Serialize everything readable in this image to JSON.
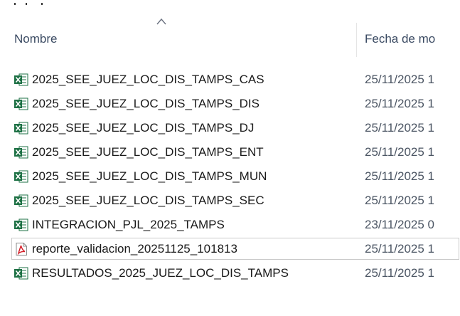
{
  "columns": {
    "name": "Nombre",
    "date": "Fecha de mo"
  },
  "files": [
    {
      "name": "2025_SEE_JUEZ_LOC_DIS_TAMPS_CAS",
      "date": "25/11/2025 1",
      "type": "excel"
    },
    {
      "name": "2025_SEE_JUEZ_LOC_DIS_TAMPS_DIS",
      "date": "25/11/2025 1",
      "type": "excel"
    },
    {
      "name": "2025_SEE_JUEZ_LOC_DIS_TAMPS_DJ",
      "date": "25/11/2025 1",
      "type": "excel"
    },
    {
      "name": "2025_SEE_JUEZ_LOC_DIS_TAMPS_ENT",
      "date": "25/11/2025 1",
      "type": "excel"
    },
    {
      "name": "2025_SEE_JUEZ_LOC_DIS_TAMPS_MUN",
      "date": "25/11/2025 1",
      "type": "excel"
    },
    {
      "name": "2025_SEE_JUEZ_LOC_DIS_TAMPS_SEC",
      "date": "25/11/2025 1",
      "type": "excel"
    },
    {
      "name": "INTEGRACION_PJL_2025_TAMPS",
      "date": "23/11/2025 0",
      "type": "excel"
    },
    {
      "name": "reporte_validacion_20251125_101813",
      "date": "25/11/2025 1",
      "type": "pdf"
    },
    {
      "name": "RESULTADOS_2025_JUEZ_LOC_DIS_TAMPS",
      "date": "25/11/2025 1",
      "type": "excel"
    }
  ],
  "icons": {
    "excel": "excel-file-icon",
    "pdf": "pdf-file-icon"
  },
  "colors": {
    "excel_green": "#1e7145",
    "pdf_red": "#d4202a",
    "header_text": "#3a4a62"
  }
}
